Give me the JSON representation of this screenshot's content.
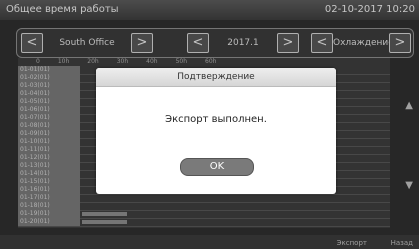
{
  "header": {
    "title": "Общее время работы",
    "datetime": "02-10-2017  10:20"
  },
  "nav": {
    "office": "South Office",
    "period": "2017.1",
    "mode": "Охлаждение"
  },
  "grid": {
    "columns": [
      "0",
      "10h",
      "20h",
      "30h",
      "40h",
      "50h",
      "60h"
    ],
    "rows": [
      {
        "label": "01-01(01)",
        "fill": 0.0
      },
      {
        "label": "01-02(01)",
        "fill": 0.0
      },
      {
        "label": "01-03(01)",
        "fill": 0.0
      },
      {
        "label": "01-04(01)",
        "fill": 0.0
      },
      {
        "label": "01-05(01)",
        "fill": 0.0
      },
      {
        "label": "01-06(01)",
        "fill": 0.0
      },
      {
        "label": "01-07(01)",
        "fill": 0.0
      },
      {
        "label": "01-08(01)",
        "fill": 0.0
      },
      {
        "label": "01-09(01)",
        "fill": 0.0
      },
      {
        "label": "01-10(01)",
        "fill": 0.0
      },
      {
        "label": "01-11(01)",
        "fill": 0.0
      },
      {
        "label": "01-12(01)",
        "fill": 0.0
      },
      {
        "label": "01-13(01)",
        "fill": 0.0
      },
      {
        "label": "01-14(01)",
        "fill": 0.0
      },
      {
        "label": "01-15(01)",
        "fill": 0.0
      },
      {
        "label": "01-16(01)",
        "fill": 0.0
      },
      {
        "label": "01-17(01)",
        "fill": 0.0
      },
      {
        "label": "01-18(01)",
        "fill": 0.0
      },
      {
        "label": "01-19(01)",
        "fill": 0.15
      },
      {
        "label": "01-20(01)",
        "fill": 0.15
      }
    ]
  },
  "bottom": {
    "export": "Экспорт",
    "back": "Назад"
  },
  "dialog": {
    "title": "Подтверждение",
    "message": "Экспорт выполнен.",
    "ok_label": "OK"
  }
}
